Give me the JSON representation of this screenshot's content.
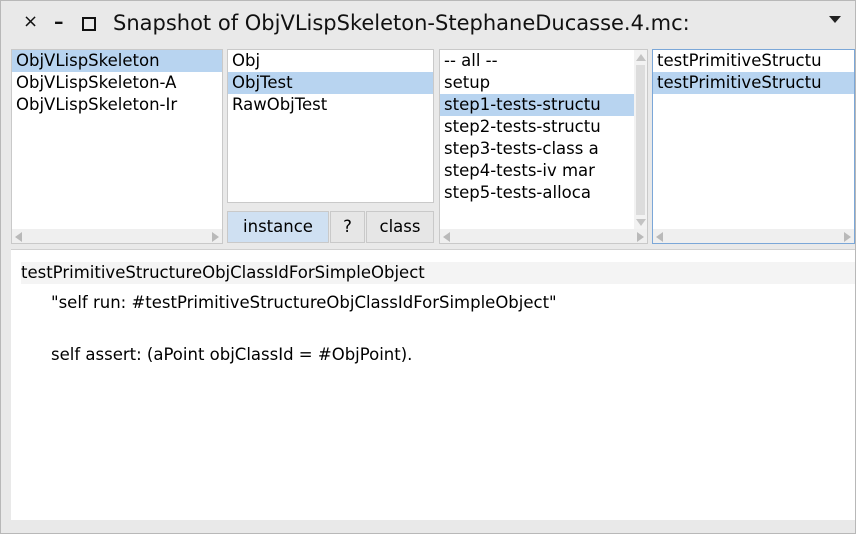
{
  "window": {
    "title": "Snapshot of ObjVLispSkeleton-StephaneDucasse.4.mc:",
    "close_glyph": "×",
    "minimize_glyph": "–"
  },
  "packages": {
    "items": [
      {
        "label": "ObjVLispSkeleton",
        "selected": true
      },
      {
        "label": "ObjVLispSkeleton-A",
        "selected": false
      },
      {
        "label": "ObjVLispSkeleton-Ir",
        "selected": false
      }
    ]
  },
  "classes": {
    "items": [
      {
        "label": "Obj",
        "selected": false
      },
      {
        "label": "ObjTest",
        "selected": true
      },
      {
        "label": "RawObjTest",
        "selected": false
      }
    ]
  },
  "categories": {
    "items": [
      {
        "label": "-- all --",
        "selected": false
      },
      {
        "label": "setup",
        "selected": false
      },
      {
        "label": "step1-tests-structu",
        "selected": true
      },
      {
        "label": "step2-tests-structu",
        "selected": false
      },
      {
        "label": "step3-tests-class a",
        "selected": false
      },
      {
        "label": "step4-tests-iv mar",
        "selected": false
      },
      {
        "label": "step5-tests-alloca",
        "selected": false
      }
    ]
  },
  "methods": {
    "items": [
      {
        "label": "testPrimitiveStructu",
        "selected": false
      },
      {
        "label": "testPrimitiveStructu",
        "selected": true
      }
    ]
  },
  "switch": {
    "instance": "instance",
    "help": "?",
    "class": "class"
  },
  "code": {
    "line1": "testPrimitiveStructureObjClassIdForSimpleObject",
    "line2": "\"self run: #testPrimitiveStructureObjClassIdForSimpleObject\"",
    "line3": "self assert: (aPoint objClassId = #ObjPoint)."
  },
  "colors": {
    "selection": "#b8d4f0",
    "focus_border": "#7ba7d8"
  }
}
